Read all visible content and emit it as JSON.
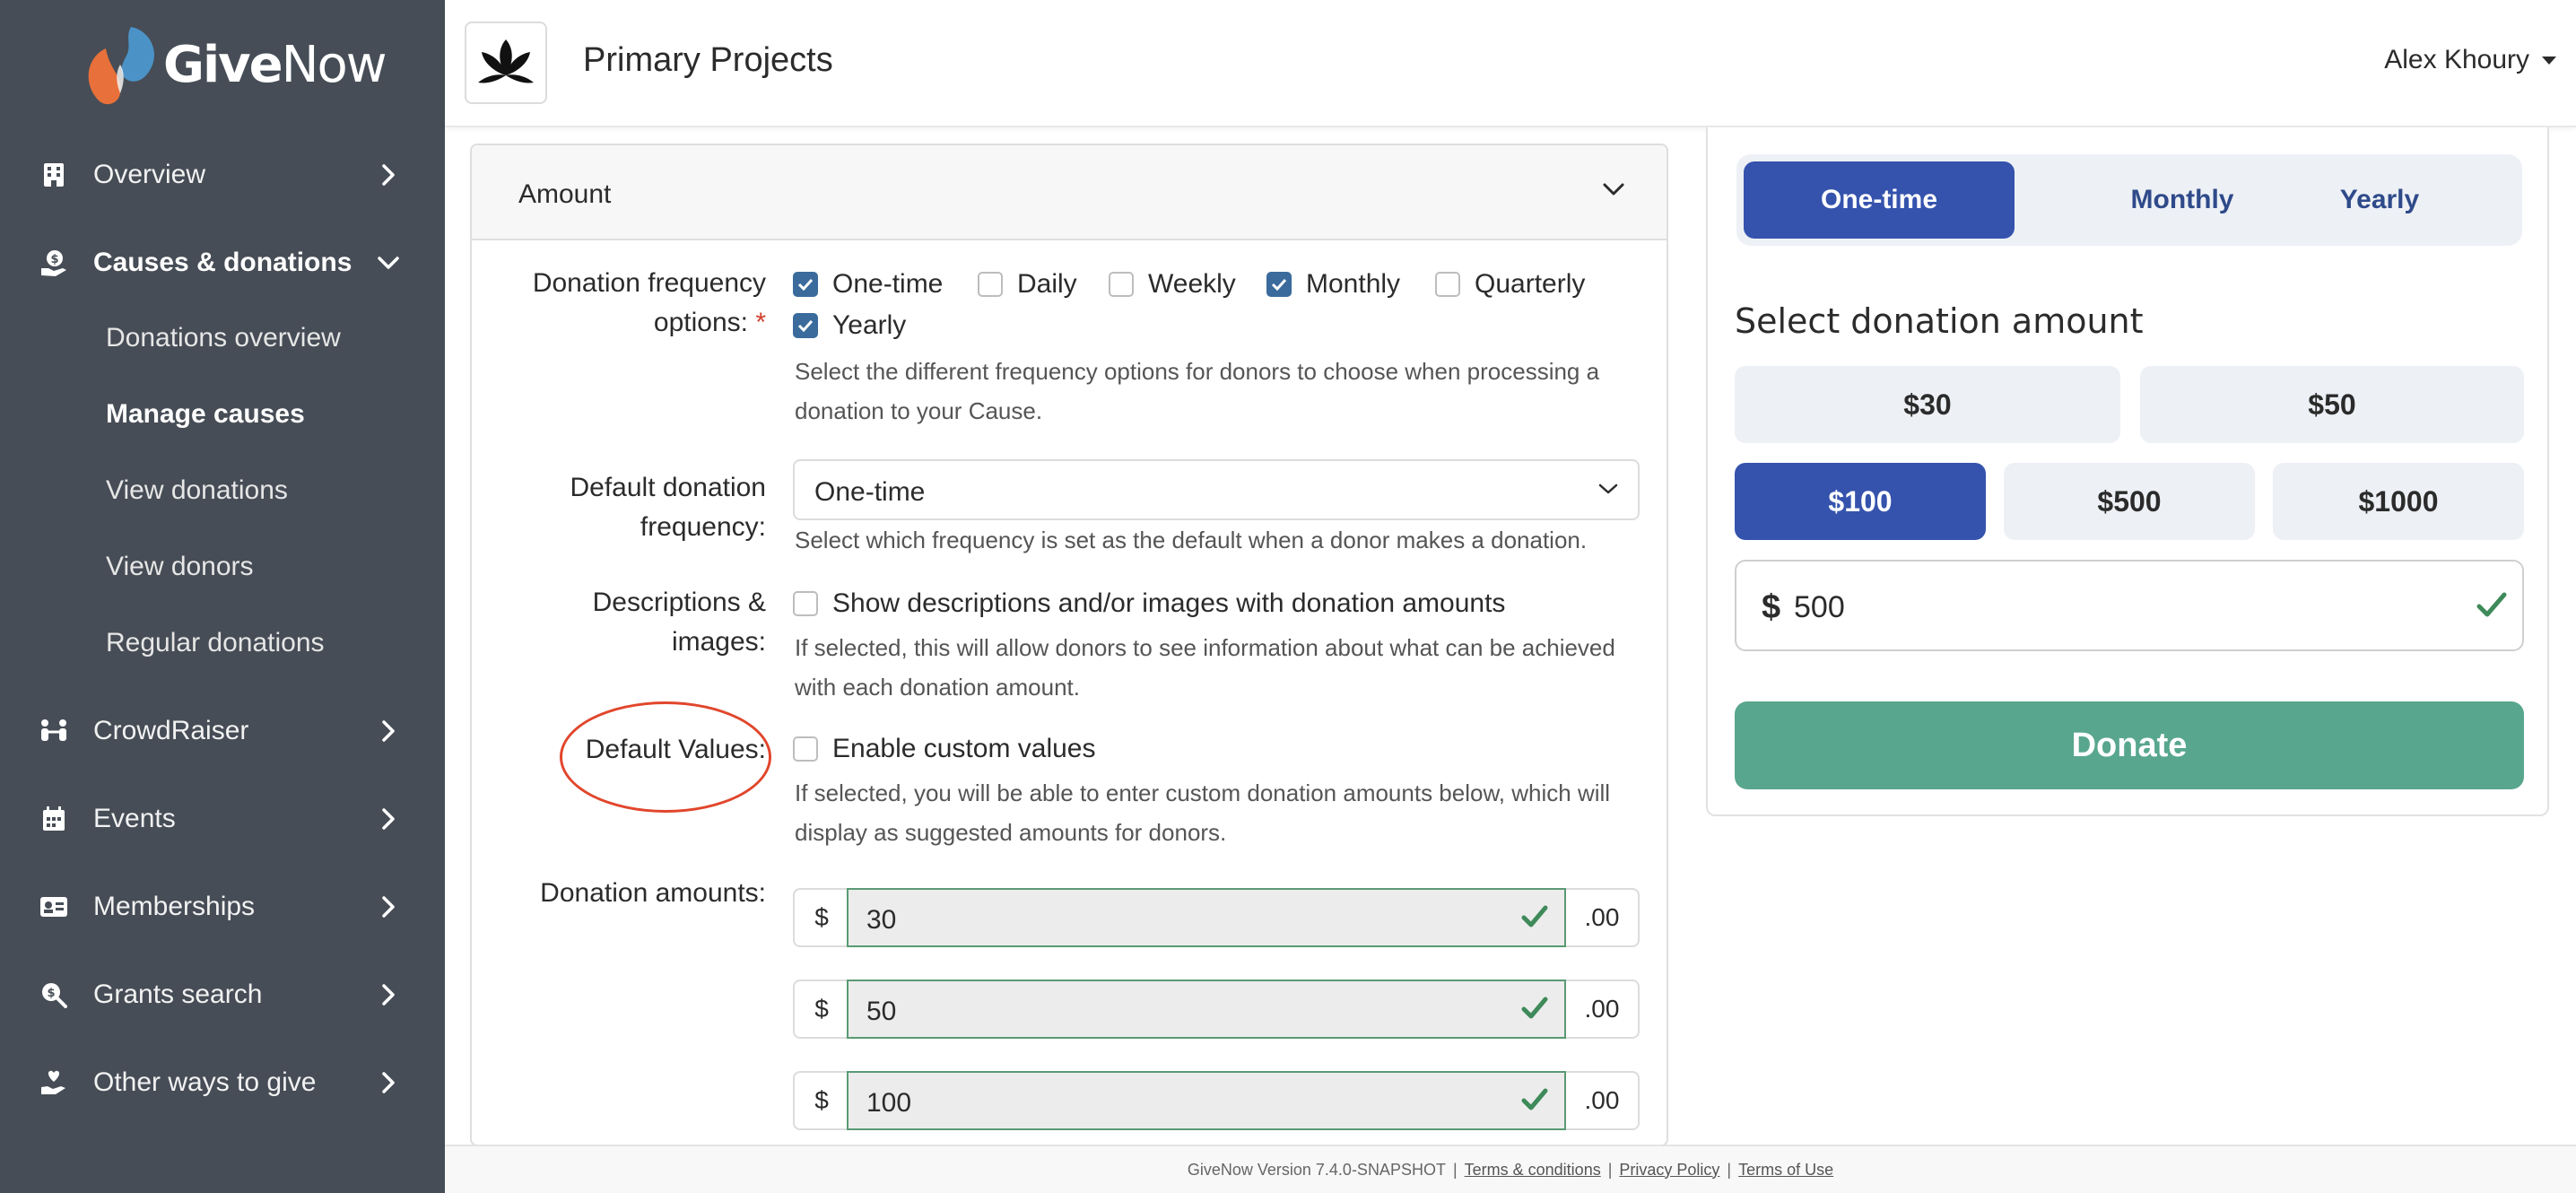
{
  "brand": {
    "name_give": "Give",
    "name_now": "Now",
    "accent_orange": "#e8703a",
    "accent_blue": "#4b93c7"
  },
  "sidebar": {
    "items": [
      {
        "label": "Overview",
        "icon": "building-icon"
      },
      {
        "label": "Causes & donations",
        "icon": "donation-icon"
      },
      {
        "label": "CrowdRaiser",
        "icon": "people-icon"
      },
      {
        "label": "Events",
        "icon": "calendar-icon"
      },
      {
        "label": "Memberships",
        "icon": "id-card-icon"
      },
      {
        "label": "Grants search",
        "icon": "search-dollar-icon"
      },
      {
        "label": "Other ways to give",
        "icon": "hand-heart-icon"
      }
    ],
    "subitems": [
      {
        "label": "Donations overview"
      },
      {
        "label": "Manage causes"
      },
      {
        "label": "View donations"
      },
      {
        "label": "View donors"
      },
      {
        "label": "Regular donations"
      }
    ]
  },
  "header": {
    "title": "Primary Projects",
    "user": "Alex Khoury"
  },
  "form": {
    "section_title": "Amount",
    "frequency_label_1": "Donation frequency",
    "frequency_label_2": "options:",
    "required_mark": "*",
    "frequency_options": [
      {
        "label": "One-time",
        "checked": true
      },
      {
        "label": "Daily",
        "checked": false
      },
      {
        "label": "Weekly",
        "checked": false
      },
      {
        "label": "Monthly",
        "checked": true
      },
      {
        "label": "Quarterly",
        "checked": false
      },
      {
        "label": "Yearly",
        "checked": true
      }
    ],
    "frequency_help_1": "Select the different frequency options for donors to choose when processing a",
    "frequency_help_2": "donation to your Cause.",
    "default_freq_label_1": "Default donation",
    "default_freq_label_2": "frequency:",
    "default_freq_value": "One-time",
    "default_freq_help": "Select which frequency is set as the default when a donor makes a donation.",
    "desc_label_1": "Descriptions &",
    "desc_label_2": "images:",
    "desc_checkbox": "Show descriptions and/or images with donation amounts",
    "desc_help_1": "If selected, this will allow donors to see information about what can be achieved",
    "desc_help_2": "with each donation amount.",
    "default_values_label": "Default Values:",
    "custom_values_checkbox": "Enable custom values",
    "custom_help_1": "If selected, you will be able to enter custom donation amounts below, which will",
    "custom_help_2": "display as suggested amounts for donors.",
    "amounts_label": "Donation amounts:",
    "currency_symbol": "$",
    "decimal_suffix": ".00",
    "amounts": [
      "30",
      "50",
      "100"
    ]
  },
  "preview": {
    "tabs": [
      "One-time",
      "Monthly",
      "Yearly"
    ],
    "active_tab": "One-time",
    "title": "Select donation amount",
    "amounts_row1": [
      "$30",
      "$50"
    ],
    "amounts_row2": [
      "$100",
      "$500",
      "$1000"
    ],
    "active_amount": "$100",
    "custom_currency": "$",
    "custom_value": "500",
    "donate_label": "Donate",
    "primary_color": "#3553ad",
    "donate_color": "#58a68e"
  },
  "footer": {
    "version": "GiveNow Version 7.4.0-SNAPSHOT",
    "separator": "|",
    "links": [
      "Terms & conditions",
      "Privacy Policy",
      "Terms of Use"
    ]
  }
}
